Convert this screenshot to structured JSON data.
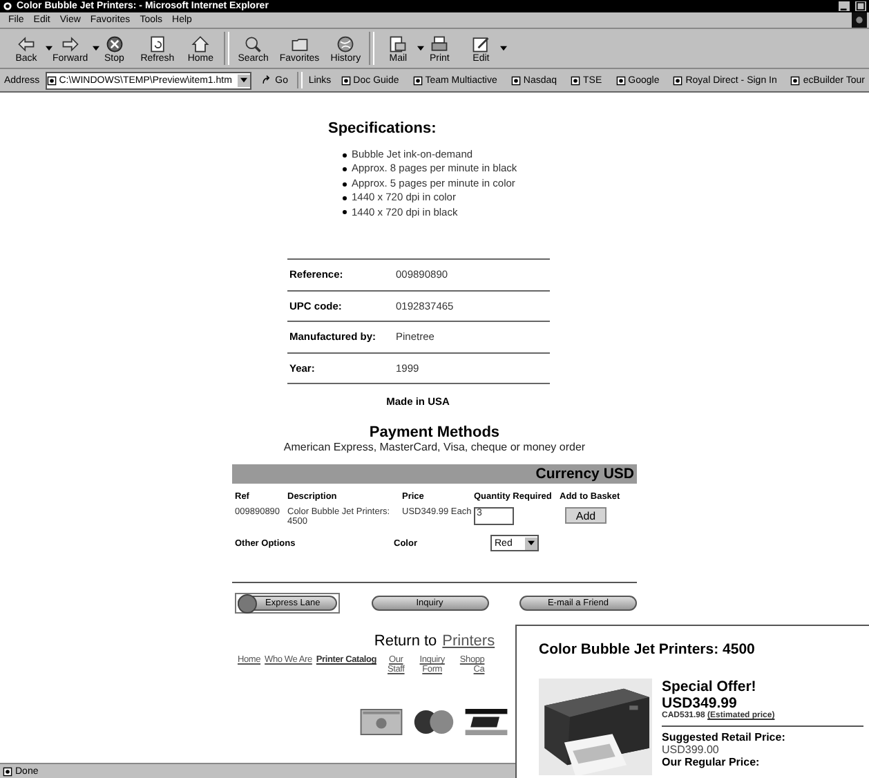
{
  "window": {
    "title": "Color Bubble Jet Printers: - Microsoft Internet Explorer"
  },
  "menu": [
    "File",
    "Edit",
    "View",
    "Favorites",
    "Tools",
    "Help"
  ],
  "toolbar": [
    {
      "label": "Back",
      "kind": "back",
      "dropdown": true
    },
    {
      "label": "Forward",
      "kind": "forward",
      "dropdown": true
    },
    {
      "label": "Stop",
      "kind": "stop",
      "dropdown": false
    },
    {
      "label": "Refresh",
      "kind": "refresh",
      "dropdown": false
    },
    {
      "label": "Home",
      "kind": "home",
      "dropdown": false
    },
    {
      "label": "Search",
      "kind": "search",
      "dropdown": false
    },
    {
      "label": "Favorites",
      "kind": "favorites",
      "dropdown": false
    },
    {
      "label": "History",
      "kind": "history",
      "dropdown": false
    },
    {
      "label": "Mail",
      "kind": "mail",
      "dropdown": true
    },
    {
      "label": "Print",
      "kind": "print",
      "dropdown": false
    },
    {
      "label": "Edit",
      "kind": "edit",
      "dropdown": true
    }
  ],
  "address": {
    "label": "Address",
    "value": "C:\\WINDOWS\\TEMP\\Preview\\item1.htm",
    "go": "Go"
  },
  "links": {
    "label": "Links",
    "items": [
      "Doc Guide",
      "Team Multiactive",
      "Nasdaq",
      "TSE",
      "Google",
      "Royal Direct - Sign In",
      "ecBuilder Tour"
    ]
  },
  "specifications": {
    "title": "Specifications:",
    "items": [
      "Bubble Jet ink-on-demand",
      "Approx. 8 pages per minute in black",
      "Approx. 5 pages per minute in color",
      "1440 x 720 dpi in color",
      "1440 x 720 dpi in black"
    ]
  },
  "details": [
    {
      "label": "Reference:",
      "value": "009890890"
    },
    {
      "label": "UPC code:",
      "value": "0192837465"
    },
    {
      "label": "Manufactured by:",
      "value": "Pinetree"
    },
    {
      "label": "Year:",
      "value": "1999"
    }
  ],
  "origin": "Made in USA",
  "payment": {
    "title": "Payment Methods",
    "text": "American Express, MasterCard, Visa, cheque or money order"
  },
  "order": {
    "currency": "Currency USD",
    "columns": [
      "Ref",
      "Description",
      "Price",
      "Quantity Required",
      "Add to Basket"
    ],
    "row": {
      "ref": "009890890",
      "description": "Color Bubble Jet Printers: 4500",
      "price": "USD349.99 Each",
      "quantity": "3",
      "button": "Add"
    },
    "options_label": "Other Options",
    "option": {
      "label": "Color",
      "value": "Red"
    }
  },
  "actions": [
    {
      "label": "Express Lane",
      "kind": "express"
    },
    {
      "label": "Inquiry",
      "kind": "plain"
    },
    {
      "label": "E-mail a Friend",
      "kind": "plain"
    }
  ],
  "return": {
    "text": "Return to",
    "link": "Printers"
  },
  "footer_links": [
    {
      "lines": [
        "Home"
      ],
      "bold": false
    },
    {
      "lines": [
        "Who We Are"
      ],
      "bold": false
    },
    {
      "lines": [
        "Printer Catalog"
      ],
      "bold": true
    },
    {
      "lines": [
        "Our",
        "Staff"
      ],
      "bold": false
    },
    {
      "lines": [
        "Inquiry",
        "Form"
      ],
      "bold": false
    },
    {
      "lines": [
        "Shopp",
        "Ca"
      ],
      "bold": false
    }
  ],
  "status_bar": {
    "text": "Done"
  },
  "popup": {
    "title": "Color Bubble Jet Printers: 4500",
    "offer": "Special Offer!",
    "price": "USD349.99",
    "converted": "CAD531.98",
    "estimate": "(Estimated price)",
    "retail_label": "Suggested Retail Price:",
    "retail": "USD399.00",
    "regular_label": "Our Regular Price:"
  }
}
